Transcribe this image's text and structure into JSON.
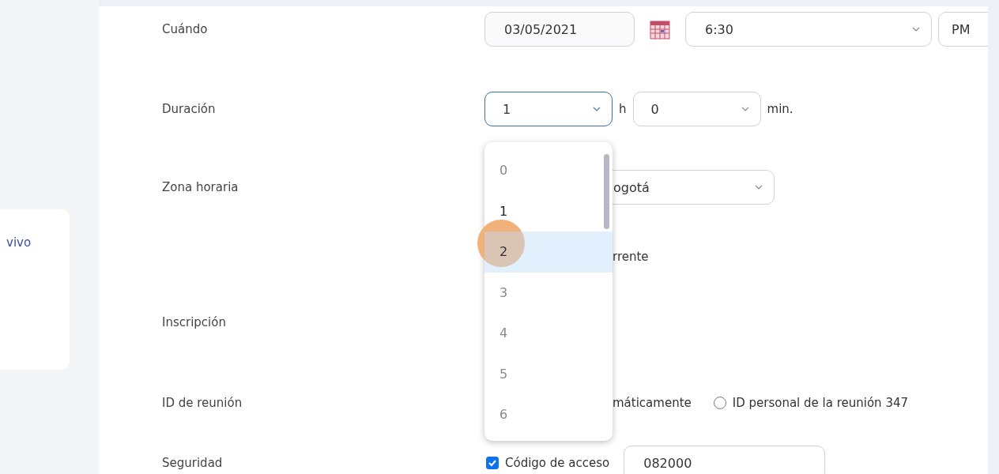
{
  "sidebar": {
    "items": [
      {
        "label": "vivo"
      }
    ]
  },
  "form": {
    "when": {
      "label": "Cuándo",
      "date": "03/05/2021",
      "time": "6:30",
      "period": "PM"
    },
    "duration": {
      "label": "Duración",
      "hours": "1",
      "hours_unit": "h",
      "minutes": "0",
      "minutes_unit": "min.",
      "focused": true
    },
    "time_zone": {
      "label": "Zona horaria",
      "value": "ogotá"
    },
    "recurring": {
      "text": "rrente"
    },
    "registration": {
      "label": "Inscripción"
    },
    "meeting_id": {
      "label": "ID de reunión",
      "text": "máticamente",
      "options": [
        {
          "label": "ID personal de la reunión 347",
          "selected": false
        }
      ]
    },
    "security": {
      "label": "Seguridad",
      "passcode_checked": true,
      "passcode_label": "Código de acceso",
      "passcode": "082000"
    }
  },
  "dropdown": {
    "options": [
      {
        "label": "0",
        "selected": false
      },
      {
        "label": "1",
        "selected": false
      },
      {
        "label": "2",
        "selected": true
      },
      {
        "label": "3",
        "selected": false
      },
      {
        "label": "4",
        "selected": false
      },
      {
        "label": "5",
        "selected": false
      },
      {
        "label": "6",
        "selected": false
      }
    ]
  }
}
